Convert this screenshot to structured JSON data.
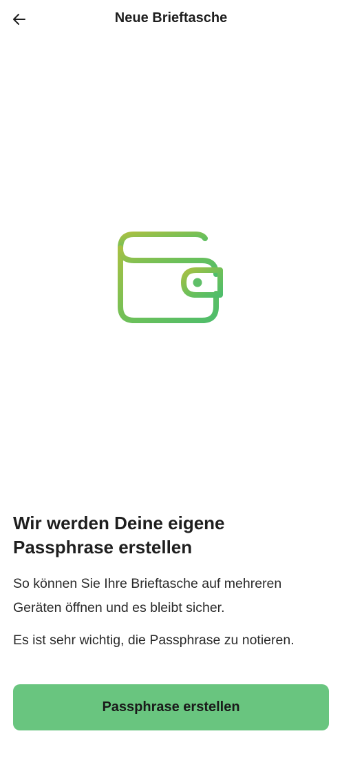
{
  "header": {
    "back_icon": "arrow-left-icon",
    "title": "Neue Brieftasche"
  },
  "illustration": {
    "icon": "wallet-icon",
    "gradient_start": "#a8c043",
    "gradient_end": "#4fbd6b"
  },
  "main": {
    "headline": "Wir werden Deine eigene Passphrase erstellen",
    "description": "So können Sie Ihre Brieftasche auf mehreren Geräten öffnen und es bleibt sicher.",
    "note": "Es ist sehr wichtig, die Passphrase zu notieren."
  },
  "cta": {
    "label": "Passphrase erstellen",
    "color": "#69c57f"
  }
}
